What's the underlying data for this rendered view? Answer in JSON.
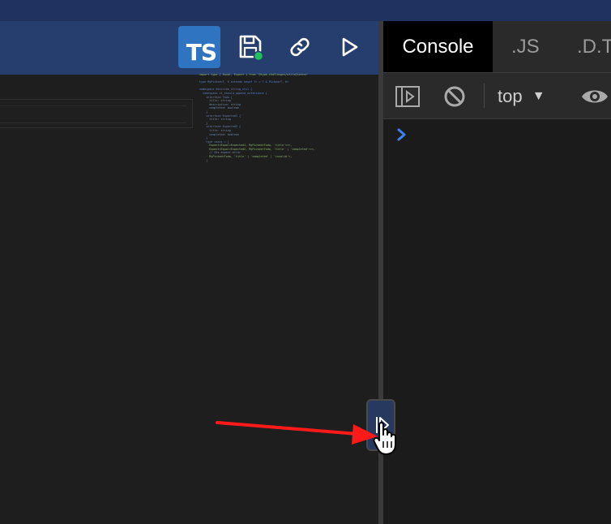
{
  "editor": {
    "language_badge": "TS",
    "toolbar": {
      "save_icon": "save-icon",
      "link_icon": "link-icon",
      "run_icon": "play-icon"
    },
    "status_color": "#21c05c",
    "minimap_lines": [
      "import type { Equal, Expect } from '@type-challenges/utils@latest'",
      "",
      "type MyPicked<T, K extends keyof T> = T & Picked<T, K>",
      "",
      "namespace describe_string_util {",
      "  namespace it_should_append_extensions {",
      "    interface Todo {",
      "      title: string",
      "      description: string",
      "      completed: boolean",
      "    }",
      "    interface Expected1 {",
      "      title: string",
      "    }",
      "    interface Expected2 {",
      "      title: string",
      "      completed: boolean",
      "    }",
      "    type cases = [",
      "      Expect<Equal<Expected1, MyPicked<Todo, 'title'>>>,",
      "      Expect<Equal<Expected2, MyPicked<Todo, 'title' | 'completed'>>>,",
      "      // @ts-expect-error",
      "      MyPicked<Todo, 'title' | 'completed' | 'invalid'>,",
      "    ]",
      "  }",
      "}"
    ]
  },
  "devtools": {
    "tabs": [
      {
        "label": "Console",
        "active": true
      },
      {
        "label": ".JS",
        "active": false
      },
      {
        "label": ".D.T",
        "active": false
      }
    ],
    "context_label": "top",
    "context_caret": "▼",
    "prompt_icon": "chevron-right-icon",
    "accent": "#3b82f6"
  },
  "floating_button": {
    "icon": "sidebar-toggle-icon"
  },
  "annotation": {
    "arrow_color": "#ff1a1a"
  }
}
